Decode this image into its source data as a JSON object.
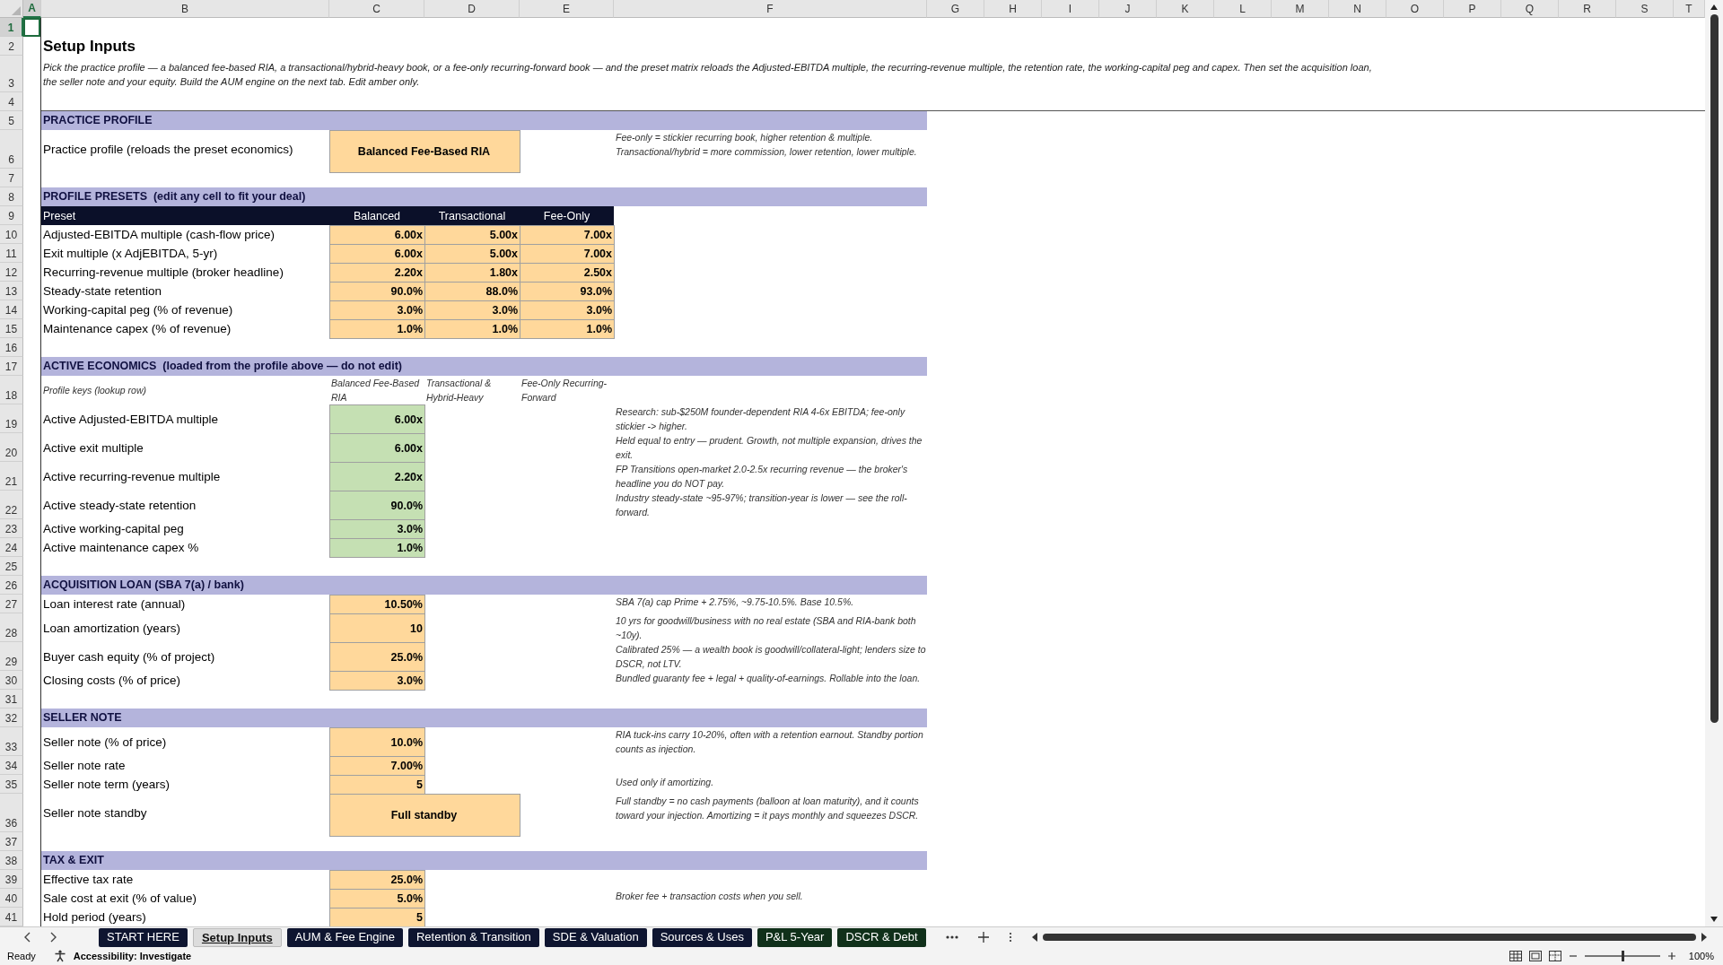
{
  "column_headers": [
    {
      "label": "A",
      "selected": true
    },
    {
      "label": "B",
      "selected": false
    },
    {
      "label": "C",
      "selected": false
    },
    {
      "label": "D",
      "selected": false
    },
    {
      "label": "E",
      "selected": false
    },
    {
      "label": "F",
      "selected": false
    },
    {
      "label": "G",
      "selected": false
    },
    {
      "label": "H",
      "selected": false
    },
    {
      "label": "I",
      "selected": false
    },
    {
      "label": "J",
      "selected": false
    },
    {
      "label": "K",
      "selected": false
    },
    {
      "label": "L",
      "selected": false
    },
    {
      "label": "M",
      "selected": false
    },
    {
      "label": "N",
      "selected": false
    },
    {
      "label": "O",
      "selected": false
    },
    {
      "label": "P",
      "selected": false
    },
    {
      "label": "Q",
      "selected": false
    },
    {
      "label": "R",
      "selected": false
    },
    {
      "label": "S",
      "selected": false
    },
    {
      "label": "T",
      "selected": false
    }
  ],
  "row_headers": [
    {
      "label": "1",
      "selected": true
    },
    {
      "label": "2",
      "selected": false
    },
    {
      "label": "3",
      "selected": false
    },
    {
      "label": "4",
      "selected": false
    },
    {
      "label": "5",
      "selected": false
    },
    {
      "label": "6",
      "selected": false
    },
    {
      "label": "7",
      "selected": false
    },
    {
      "label": "8",
      "selected": false
    },
    {
      "label": "9",
      "selected": false
    },
    {
      "label": "10",
      "selected": false
    },
    {
      "label": "11",
      "selected": false
    },
    {
      "label": "12",
      "selected": false
    },
    {
      "label": "13",
      "selected": false
    },
    {
      "label": "14",
      "selected": false
    },
    {
      "label": "15",
      "selected": false
    },
    {
      "label": "16",
      "selected": false
    },
    {
      "label": "17",
      "selected": false
    },
    {
      "label": "18",
      "selected": false
    },
    {
      "label": "19",
      "selected": false
    },
    {
      "label": "20",
      "selected": false
    },
    {
      "label": "21",
      "selected": false
    },
    {
      "label": "22",
      "selected": false
    },
    {
      "label": "23",
      "selected": false
    },
    {
      "label": "24",
      "selected": false
    },
    {
      "label": "25",
      "selected": false
    },
    {
      "label": "26",
      "selected": false
    },
    {
      "label": "27",
      "selected": false
    },
    {
      "label": "28",
      "selected": false
    },
    {
      "label": "29",
      "selected": false
    },
    {
      "label": "30",
      "selected": false
    },
    {
      "label": "31",
      "selected": false
    },
    {
      "label": "32",
      "selected": false
    },
    {
      "label": "33",
      "selected": false
    },
    {
      "label": "34",
      "selected": false
    },
    {
      "label": "35",
      "selected": false
    },
    {
      "label": "36",
      "selected": false
    },
    {
      "label": "37",
      "selected": false
    },
    {
      "label": "38",
      "selected": false
    },
    {
      "label": "39",
      "selected": false
    },
    {
      "label": "40",
      "selected": false
    },
    {
      "label": "41",
      "selected": false
    }
  ],
  "title": "Setup Inputs",
  "intro": "Pick the practice profile — a balanced fee-based RIA, a transactional/hybrid-heavy book, or a fee-only recurring-forward book — and the preset matrix reloads the Adjusted-EBITDA multiple, the recurring-revenue multiple, the retention rate, the working-capital peg and capex. Then set the acquisition loan, the seller note and your equity. Build the AUM engine on the next tab. Edit amber only.",
  "sections": [
    {
      "heading": "PRACTICE PROFILE",
      "rows": [
        {
          "kind": "selector",
          "label": "Practice profile (reloads the preset economics)",
          "value": "Balanced Fee-Based RIA",
          "note": "Fee-only = stickier recurring book, higher retention & multiple.\nTransactional/hybrid = more commission, lower retention, lower multiple."
        }
      ]
    },
    {
      "heading": "PROFILE PRESETS  (edit any cell to fit your deal)",
      "columns": [
        "Preset",
        "Balanced",
        "Transactional",
        "Fee-Only"
      ],
      "rows": [
        {
          "kind": "preset",
          "label": "Adjusted-EBITDA multiple (cash-flow price)",
          "values": [
            "6.00x",
            "5.00x",
            "7.00x"
          ]
        },
        {
          "kind": "preset",
          "label": "Exit multiple (x AdjEBITDA, 5-yr)",
          "values": [
            "6.00x",
            "5.00x",
            "7.00x"
          ]
        },
        {
          "kind": "preset",
          "label": "Recurring-revenue multiple (broker headline)",
          "values": [
            "2.20x",
            "1.80x",
            "2.50x"
          ]
        },
        {
          "kind": "preset",
          "label": "Steady-state retention",
          "values": [
            "90.0%",
            "88.0%",
            "93.0%"
          ]
        },
        {
          "kind": "preset",
          "label": "Working-capital peg (% of revenue)",
          "values": [
            "3.0%",
            "3.0%",
            "3.0%"
          ]
        },
        {
          "kind": "preset",
          "label": "Maintenance capex (% of revenue)",
          "values": [
            "1.0%",
            "1.0%",
            "1.0%"
          ]
        }
      ]
    },
    {
      "heading": "ACTIVE ECONOMICS  (loaded from the profile above — do not edit)",
      "keys": {
        "label": "Profile keys (lookup row)",
        "values": [
          "Balanced Fee-Based RIA",
          "Transactional & Hybrid-Heavy",
          "Fee-Only Recurring-Forward"
        ]
      },
      "rows": [
        {
          "kind": "formula",
          "label": "Active Adjusted-EBITDA multiple",
          "value": "6.00x",
          "note": "Research: sub-$250M founder-dependent RIA 4-6x EBITDA; fee-only stickier -> higher."
        },
        {
          "kind": "formula",
          "label": "Active exit multiple",
          "value": "6.00x",
          "note": "Held equal to entry — prudent. Growth, not multiple expansion, drives the exit."
        },
        {
          "kind": "formula",
          "label": "Active recurring-revenue multiple",
          "value": "2.20x",
          "note": "FP Transitions open-market 2.0-2.5x recurring revenue — the broker's headline you do NOT pay."
        },
        {
          "kind": "formula",
          "label": "Active steady-state retention",
          "value": "90.0%",
          "note": "Industry steady-state ~95-97%; transition-year is lower — see the roll-forward."
        },
        {
          "kind": "formula",
          "label": "Active working-capital peg",
          "value": "3.0%"
        },
        {
          "kind": "formula",
          "label": "Active maintenance capex %",
          "value": "1.0%"
        }
      ]
    },
    {
      "heading": "ACQUISITION LOAN (SBA 7(a) / bank)",
      "rows": [
        {
          "kind": "input",
          "label": "Loan interest rate (annual)",
          "value": "10.50%",
          "note": "SBA 7(a) cap Prime + 2.75%, ~9.75-10.5%. Base 10.5%."
        },
        {
          "kind": "input",
          "label": "Loan amortization (years)",
          "value": "10",
          "note": "10 yrs for goodwill/business with no real estate (SBA and RIA-bank both ~10y)."
        },
        {
          "kind": "input",
          "label": "Buyer cash equity (% of project)",
          "value": "25.0%",
          "note": "Calibrated 25% — a wealth book is goodwill/collateral-light; lenders size to DSCR, not LTV."
        },
        {
          "kind": "input",
          "label": "Closing costs (% of price)",
          "value": "3.0%",
          "note": "Bundled guaranty fee + legal + quality-of-earnings. Rollable into the loan."
        }
      ]
    },
    {
      "heading": "SELLER NOTE",
      "rows": [
        {
          "kind": "input",
          "label": "Seller note (% of price)",
          "value": "10.0%",
          "note": "RIA tuck-ins carry 10-20%, often with a retention earnout. Standby portion counts as injection."
        },
        {
          "kind": "input",
          "label": "Seller note rate",
          "value": "7.00%"
        },
        {
          "kind": "input",
          "label": "Seller note term (years)",
          "value": "5",
          "note": "Used only if amortizing."
        },
        {
          "kind": "selector",
          "label": "Seller note standby",
          "value": "Full standby",
          "note": "Full standby = no cash payments (balloon at loan maturity), and it counts toward your injection. Amortizing = it pays monthly and squeezes DSCR."
        }
      ]
    },
    {
      "heading": "TAX & EXIT",
      "rows": [
        {
          "kind": "input",
          "label": "Effective tax rate",
          "value": "25.0%"
        },
        {
          "kind": "input",
          "label": "Sale cost at exit (% of value)",
          "value": "5.0%",
          "note": "Broker fee + transaction costs when you sell."
        },
        {
          "kind": "input",
          "label": "Hold period (years)",
          "value": "5"
        }
      ]
    }
  ],
  "tabs": [
    {
      "label": "START HERE",
      "selected": false,
      "color": "#0e1530"
    },
    {
      "label": "Setup Inputs",
      "selected": true
    },
    {
      "label": "AUM & Fee Engine",
      "selected": false,
      "color": "#0e1530"
    },
    {
      "label": "Retention & Transition",
      "selected": false,
      "color": "#0e1530"
    },
    {
      "label": "SDE & Valuation",
      "selected": false,
      "color": "#0e1530"
    },
    {
      "label": "Sources & Uses",
      "selected": false,
      "color": "#0e1530"
    },
    {
      "label": "P&L 5-Year",
      "selected": false,
      "color": "#10301a"
    },
    {
      "label": "DSCR & Debt",
      "selected": false,
      "color": "#10301a"
    }
  ],
  "status_bar": {
    "mode": "Ready",
    "accessibility": "Accessibility: Investigate",
    "zoom": {
      "reading": "100%",
      "level": 0.5
    }
  }
}
